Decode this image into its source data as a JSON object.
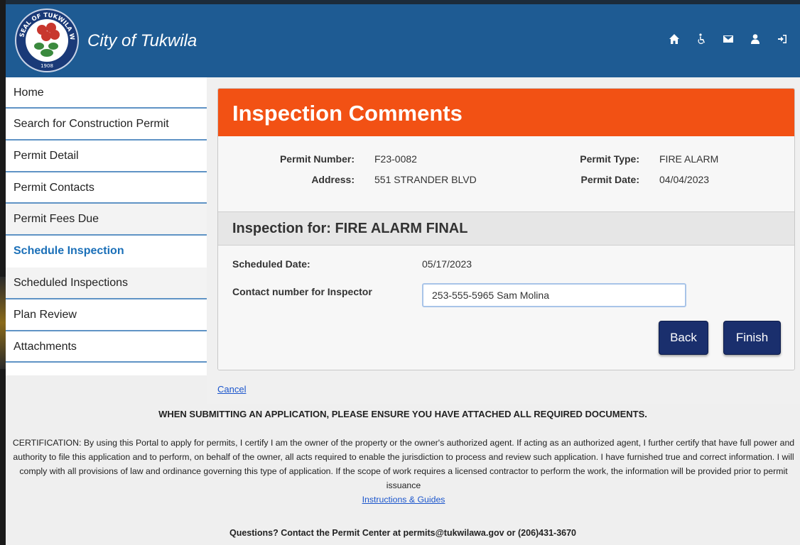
{
  "header": {
    "brand": "City of Tukwila",
    "seal_top_text": "SEAL OF TUKWILA WASHINGTON",
    "seal_year": "1908",
    "colors": {
      "header_bg": "#1e5b93",
      "title_bar": "#f25114",
      "button": "#1a2f6d"
    },
    "icons": [
      "home-icon",
      "accessibility-icon",
      "mail-icon",
      "user-icon",
      "logout-icon"
    ]
  },
  "sidebar": {
    "items": [
      {
        "label": "Home"
      },
      {
        "label": "Search for Construction Permit"
      },
      {
        "label": "Permit Detail"
      },
      {
        "label": "Permit Contacts"
      },
      {
        "label": "Permit Fees Due"
      },
      {
        "label": "Schedule Inspection"
      },
      {
        "label": "Scheduled Inspections"
      },
      {
        "label": "Plan Review"
      },
      {
        "label": "Attachments"
      }
    ],
    "active_index": 5
  },
  "card": {
    "title": "Inspection Comments",
    "permit_number_label": "Permit Number:",
    "permit_number": "F23-0082",
    "address_label": "Address:",
    "address": "551 STRANDER BLVD",
    "permit_type_label": "Permit Type:",
    "permit_type": "FIRE ALARM",
    "permit_date_label": "Permit Date:",
    "permit_date": "04/04/2023",
    "inspection_heading": "Inspection for: FIRE ALARM FINAL",
    "scheduled_date_label": "Scheduled Date:",
    "scheduled_date": "05/17/2023",
    "contact_label": "Contact number for Inspector",
    "contact_value": "253-555-5965 Sam Molina",
    "back_label": "Back",
    "finish_label": "Finish"
  },
  "cancel_label": "Cancel",
  "footer": {
    "warning": "WHEN SUBMITTING AN APPLICATION, PLEASE ENSURE YOU HAVE ATTACHED ALL REQUIRED DOCUMENTS.",
    "certification": "CERTIFICATION: By using this Portal to apply for permits, I certify I am the owner of the property or the owner's authorized agent. If acting as an authorized agent, I further certify that have full power and authority to file this application and to perform, on behalf of the owner, all acts required to enable the jurisdiction to process and review such application. I have furnished true and correct information. I will comply with all provisions of law and ordinance governing this type of application. If the scope of work requires a licensed contractor to perform the work, the information will be provided prior to permit issuance",
    "guides_link": "Instructions & Guides",
    "questions": "Questions? Contact the Permit Center at permits@tukwilawa.gov or (206)431-3670"
  }
}
